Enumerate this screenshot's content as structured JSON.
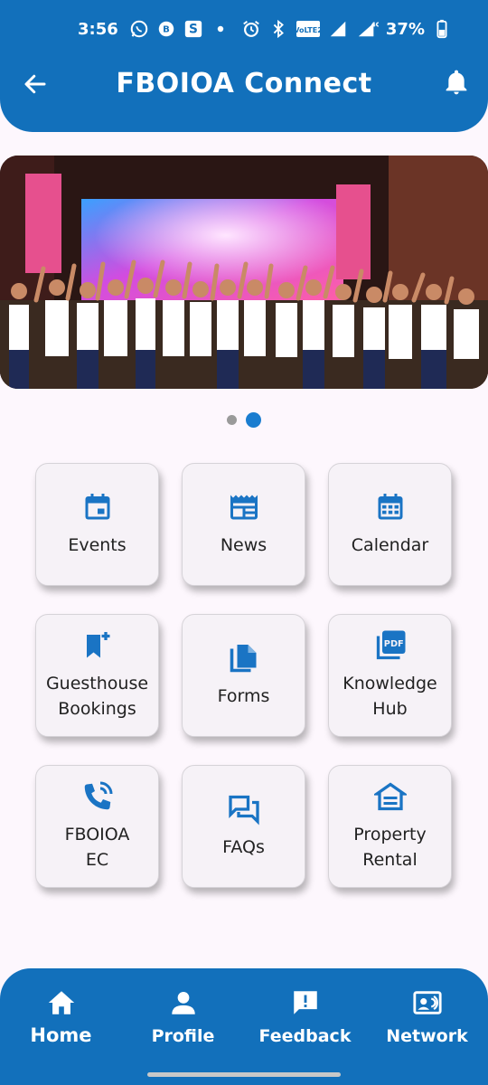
{
  "status_bar": {
    "time": "3:56",
    "battery": "37%",
    "network": "4G",
    "volte": "VoLTE2",
    "icons": [
      "whatsapp-icon",
      "whatsapp-business-icon",
      "s-app-icon",
      "dot-icon",
      "alarm-icon",
      "bluetooth-icon",
      "volte-icon",
      "signal-icon",
      "signal-4g-icon",
      "battery-icon"
    ]
  },
  "app_bar": {
    "title": "FBOIOA Connect",
    "back_icon": "arrow-back-icon",
    "notification_icon": "bell-icon"
  },
  "carousel": {
    "slide_count": 2,
    "active_index": 1
  },
  "grid": {
    "items": [
      {
        "label": "Events",
        "icon": "calendar-event-icon"
      },
      {
        "label": "News",
        "icon": "newspaper-icon"
      },
      {
        "label": "Calendar",
        "icon": "calendar-month-icon"
      },
      {
        "label": "Guesthouse\nBookings",
        "icon": "bookmark-add-icon"
      },
      {
        "label": "Forms",
        "icon": "file-copy-icon"
      },
      {
        "label": "Knowledge\nHub",
        "icon": "pdf-icon"
      },
      {
        "label": "FBOIOA\nEC",
        "icon": "phone-call-icon"
      },
      {
        "label": "FAQs",
        "icon": "forum-icon"
      },
      {
        "label": "Property\nRental",
        "icon": "house-icon"
      }
    ]
  },
  "bottom_nav": {
    "items": [
      {
        "label": "Home",
        "icon": "home-icon",
        "active": true
      },
      {
        "label": "Profile",
        "icon": "person-icon",
        "active": false
      },
      {
        "label": "Feedback",
        "icon": "feedback-icon",
        "active": false
      },
      {
        "label": "Network",
        "icon": "contact-card-icon",
        "active": false
      }
    ]
  },
  "colors": {
    "primary": "#1270bb",
    "icon_blue": "#1a74c4",
    "background": "#fdf7fd",
    "card": "#f6f2f7"
  }
}
